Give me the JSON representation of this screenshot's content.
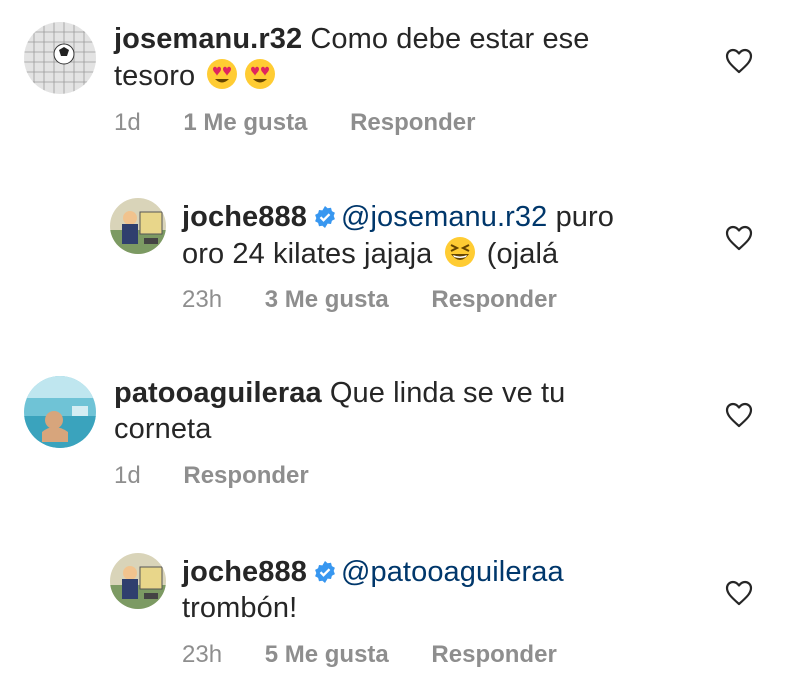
{
  "comments": [
    {
      "username": "josemanu.r32",
      "text_line1": "Como debe estar ese",
      "text_line2": "tesoro",
      "emojis": [
        "heart-eyes-emoji",
        "heart-eyes-emoji"
      ],
      "time": "1d",
      "likes": "1 Me gusta",
      "reply": "Responder",
      "verified": false
    },
    {
      "username": "joche888",
      "mention": "@josemanu.r32",
      "text_line1": "puro",
      "text_line2": "oro 24 kilates jajaja",
      "text_after_emoji": "(ojalá",
      "emojis": [
        "grinning-squinting-emoji"
      ],
      "time": "23h",
      "likes": "3 Me gusta",
      "reply": "Responder",
      "verified": true
    },
    {
      "username": "patooaguileraa",
      "text_line1": "Que linda se ve tu",
      "text_line2": "corneta",
      "time": "1d",
      "reply": "Responder",
      "verified": false
    },
    {
      "username": "joche888",
      "mention": "@patooaguileraa",
      "text_line2": "trombón!",
      "time": "23h",
      "likes": "5 Me gusta",
      "reply": "Responder",
      "verified": true
    }
  ],
  "icons": {
    "like": "heart-outline-icon",
    "verified": "verified-badge-icon"
  },
  "colors": {
    "text": "#262626",
    "secondary": "#8e8e8e",
    "mention": "#00376b",
    "verified": "#3897f0"
  }
}
